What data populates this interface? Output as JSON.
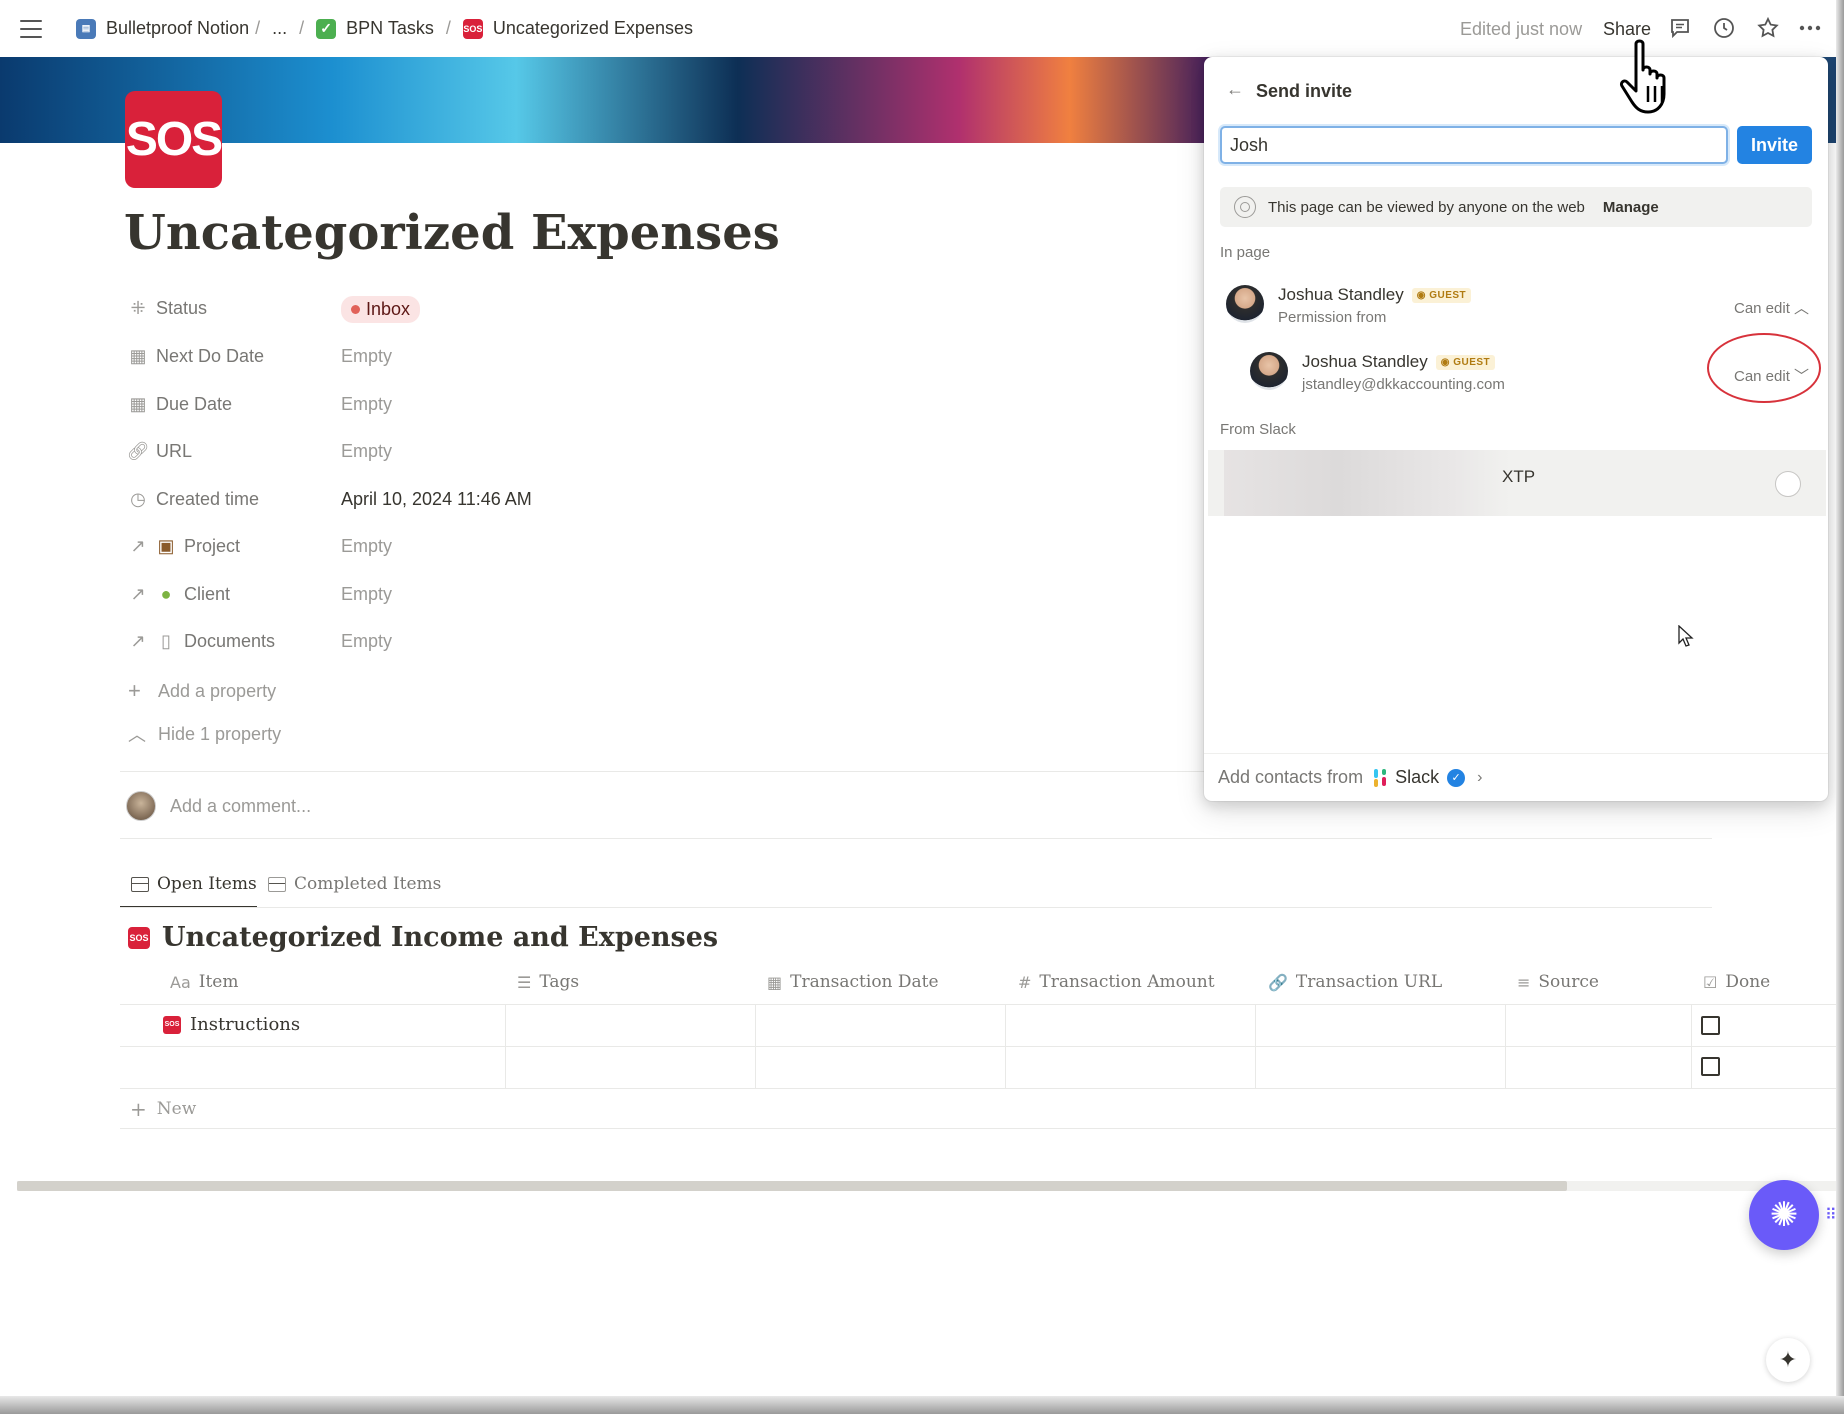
{
  "topbar": {
    "breadcrumbs": [
      {
        "label": "Bulletproof Notion",
        "icon": "database-icon"
      },
      {
        "label": "...",
        "icon": ""
      },
      {
        "label": "BPN Tasks",
        "icon": "checkbox-icon"
      },
      {
        "label": "Uncategorized Expenses",
        "icon": "sos-icon"
      }
    ],
    "separator": "/",
    "edited": "Edited just now",
    "share": "Share"
  },
  "page": {
    "logo_text": "SOS",
    "title": "Uncategorized Expenses",
    "properties": [
      {
        "label": "Status",
        "value": "Inbox",
        "icon": "status-spinner-icon"
      },
      {
        "label": "Next Do Date",
        "value": "Empty",
        "icon": "calendar-icon"
      },
      {
        "label": "Due Date",
        "value": "Empty",
        "icon": "calendar-icon"
      },
      {
        "label": "URL",
        "value": "Empty",
        "icon": "link-icon"
      },
      {
        "label": "Created time",
        "value": "April 10, 2024 11:46 AM",
        "icon": "clock-icon"
      },
      {
        "label": "Project",
        "value": "Empty",
        "icon": "relation-arrow-icon"
      },
      {
        "label": "Client",
        "value": "Empty",
        "icon": "relation-arrow-icon"
      },
      {
        "label": "Documents",
        "value": "Empty",
        "icon": "relation-arrow-icon"
      }
    ],
    "add_property": "Add a property",
    "hide_property": "Hide 1 property",
    "comment_placeholder": "Add a comment..."
  },
  "database": {
    "tabs": [
      {
        "label": "Open Items",
        "active": true
      },
      {
        "label": "Completed Items",
        "active": false
      }
    ],
    "title": "Uncategorized Income and Expenses",
    "columns": [
      {
        "label": "Item",
        "icon": "Aa"
      },
      {
        "label": "Tags",
        "icon": "☰"
      },
      {
        "label": "Transaction Date",
        "icon": "▦"
      },
      {
        "label": "Transaction Amount",
        "icon": "#"
      },
      {
        "label": "Transaction URL",
        "icon": "🔗"
      },
      {
        "label": "Source",
        "icon": "≡"
      },
      {
        "label": "Done",
        "icon": "☑"
      }
    ],
    "rows": [
      {
        "item": "Instructions",
        "done": false
      },
      {
        "item": "",
        "done": false
      }
    ],
    "new_label": "New"
  },
  "share_popover": {
    "title": "Send invite",
    "input_value": "Josh",
    "invite_button": "Invite",
    "web_notice": "This page can be viewed by anyone on the web",
    "manage": "Manage",
    "in_page_label": "In page",
    "people": [
      {
        "name": "Joshua Standley",
        "badge": "GUEST",
        "sub": "Permission from",
        "permission": "Can edit"
      },
      {
        "name": "Joshua Standley",
        "badge": "GUEST",
        "sub": "jstandley@dkkaccounting.com",
        "permission": "Can edit"
      }
    ],
    "from_slack_label": "From Slack",
    "slack_result_text": "XTP",
    "footer_text": "Add contacts from",
    "footer_service": "Slack"
  },
  "colors": {
    "accent": "#2383e2",
    "sos_red": "#d9213a",
    "fab": "#6a5af9",
    "annotation_red": "#d7323b"
  }
}
